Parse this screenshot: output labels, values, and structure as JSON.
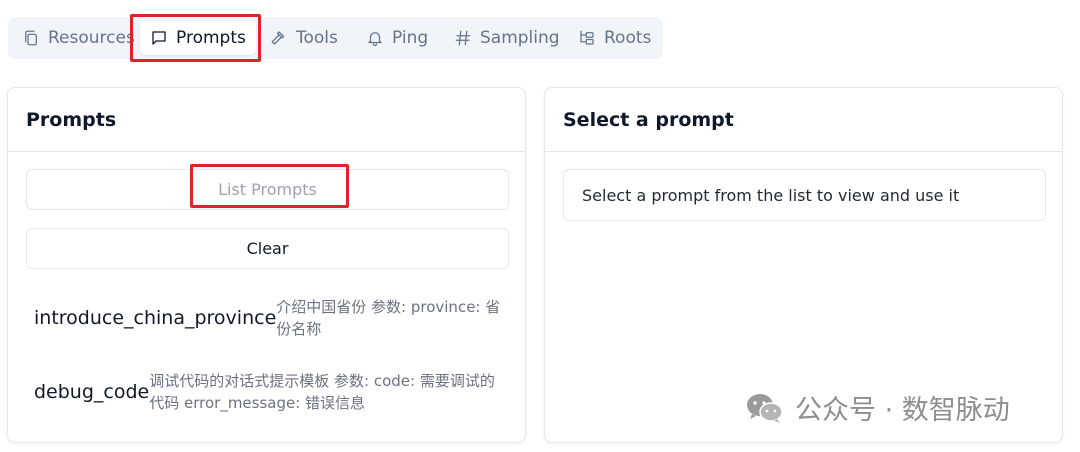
{
  "tabs": [
    {
      "label": "Resources",
      "icon": "files-icon"
    },
    {
      "label": "Prompts",
      "icon": "message-square-icon",
      "active": true
    },
    {
      "label": "Tools",
      "icon": "hammer-icon"
    },
    {
      "label": "Ping",
      "icon": "bell-icon"
    },
    {
      "label": "Sampling",
      "icon": "hash-icon"
    },
    {
      "label": "Roots",
      "icon": "folder-tree-icon"
    }
  ],
  "prompts_panel": {
    "title": "Prompts",
    "list_button": "List Prompts",
    "clear_button": "Clear",
    "items": [
      {
        "name": "introduce_china_province",
        "description": "介绍中国省份 参数: province: 省份名称"
      },
      {
        "name": "debug_code",
        "description": "调试代码的对话式提示模板 参数: code: 需要调试的代码 error_message: 错误信息"
      }
    ]
  },
  "detail_panel": {
    "title": "Select a prompt",
    "placeholder": "Select a prompt from the list to view and use it"
  },
  "watermark": {
    "text": "公众号 · 数智脉动",
    "icon": "wechat-icon"
  },
  "colors": {
    "highlight": "#e0232a",
    "tabbar_bg": "#f1f5f9",
    "muted_text": "#6b7280"
  }
}
